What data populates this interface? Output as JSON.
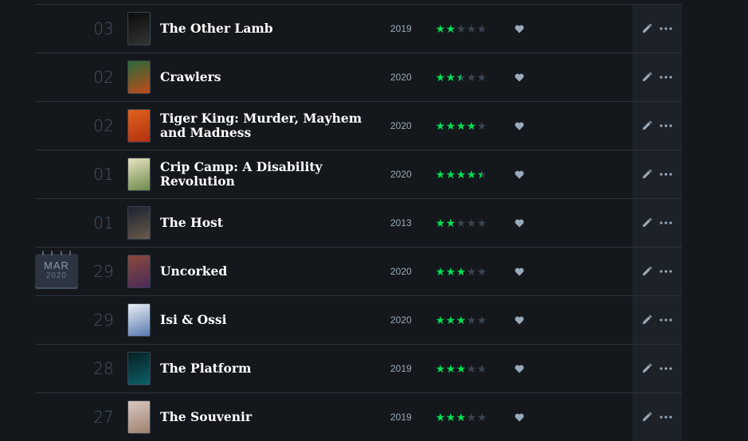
{
  "month_badge": {
    "month": "MAR",
    "year": "2020"
  },
  "entries": [
    {
      "day": "03",
      "title": "The Other Lamb",
      "year": "2019",
      "rating": 2,
      "poster": [
        "#0c0c0c",
        "#333333"
      ]
    },
    {
      "day": "02",
      "title": "Crawlers",
      "year": "2020",
      "rating": 2.5,
      "poster": [
        "#2a6a3a",
        "#c04a1a"
      ]
    },
    {
      "day": "02",
      "title": "Tiger King: Murder, Mayhem and Madness",
      "year": "2020",
      "rating": 4,
      "poster": [
        "#e0621c",
        "#b33010"
      ]
    },
    {
      "day": "01",
      "title": "Crip Camp: A Disability Revolution",
      "year": "2020",
      "rating": 4.5,
      "poster": [
        "#e9e2c0",
        "#6b8a4a"
      ]
    },
    {
      "day": "01",
      "title": "The Host",
      "year": "2013",
      "rating": 2,
      "poster": [
        "#1a2230",
        "#6a5a4a"
      ]
    },
    {
      "day": "29",
      "title": "Uncorked",
      "year": "2020",
      "rating": 3,
      "poster": [
        "#8a4a3a",
        "#4a2a5a"
      ]
    },
    {
      "day": "29",
      "title": "Isi & Ossi",
      "year": "2020",
      "rating": 3,
      "poster": [
        "#e8eef4",
        "#5a7ab0"
      ]
    },
    {
      "day": "28",
      "title": "The Platform",
      "year": "2019",
      "rating": 3,
      "poster": [
        "#062024",
        "#0e6068"
      ]
    },
    {
      "day": "27",
      "title": "The Souvenir",
      "year": "2019",
      "rating": 3,
      "poster": [
        "#d8c8c0",
        "#a08070"
      ]
    }
  ],
  "icons": {
    "like": "heart-icon",
    "edit": "pencil-icon",
    "more": "more-dots-icon"
  },
  "colors": {
    "star_on": "#00e054",
    "star_off": "#3a4450",
    "background": "#14181c",
    "actions_column": "#1c2228"
  }
}
